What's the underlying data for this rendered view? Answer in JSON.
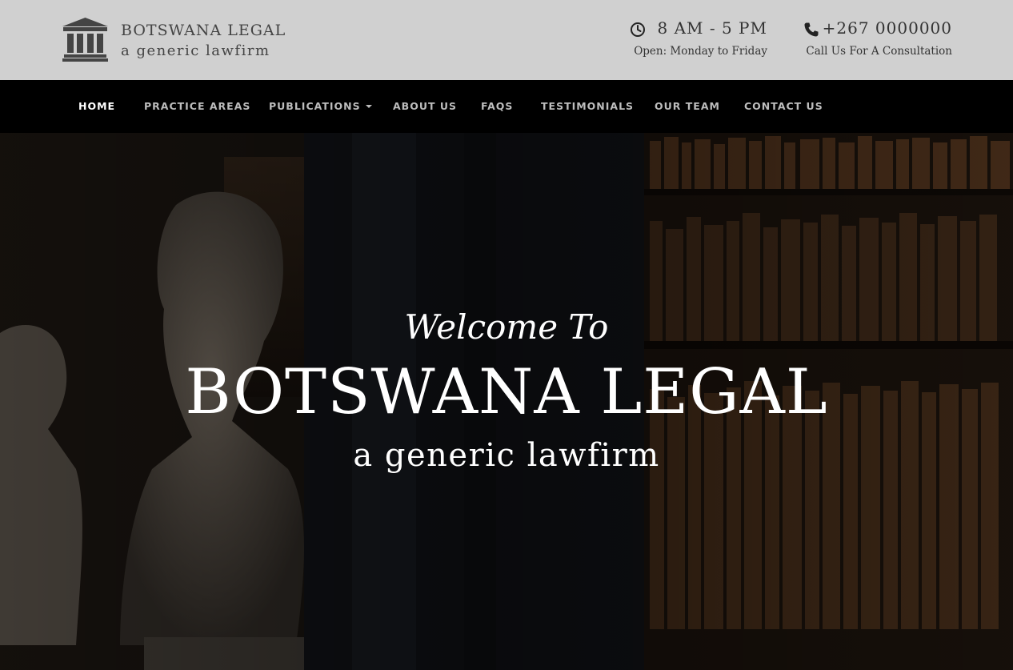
{
  "header": {
    "brand_name": "BOTSWANA LEGAL",
    "brand_tagline": "a generic lawfirm",
    "hours": {
      "icon": "clock-icon",
      "time": "8 AM - 5 PM",
      "days": "Open: Monday to Friday"
    },
    "phone": {
      "icon": "phone-icon",
      "number": "+267 0000000",
      "note": "Call Us For A Consultation"
    }
  },
  "nav": {
    "items": [
      {
        "label": "HOME",
        "active": true
      },
      {
        "label": "PRACTICE AREAS"
      },
      {
        "label": "PUBLICATIONS",
        "dropdown": true
      },
      {
        "label": "ABOUT US"
      },
      {
        "label": "FAQS"
      },
      {
        "label": "TESTIMONIALS"
      },
      {
        "label": "OUR TEAM"
      },
      {
        "label": "CONTACT US"
      }
    ]
  },
  "hero": {
    "welcome": "Welcome To",
    "title": "BOTSWANA LEGAL",
    "subtitle": "a generic lawfirm"
  },
  "colors": {
    "header_bg": "#d0d0d0",
    "nav_bg": "#000000",
    "nav_text": "#bdbdbd",
    "nav_active": "#ffffff",
    "hero_text": "#ffffff"
  }
}
